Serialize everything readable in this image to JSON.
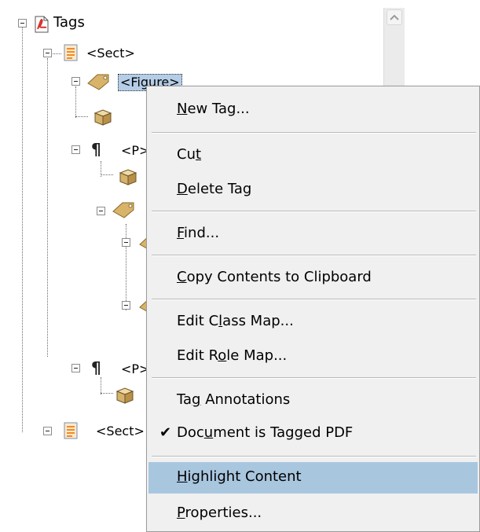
{
  "tree": {
    "root_label": "Tags",
    "sect_label": "<Sect>",
    "figure_label": "<Figure>",
    "p_label": "<P>",
    "sect_label_2": "<Sect>"
  },
  "menu": {
    "new_tag": {
      "pre": "",
      "key": "N",
      "post": "ew Tag..."
    },
    "cut": {
      "pre": "Cu",
      "key": "t",
      "post": ""
    },
    "delete_tag": {
      "pre": "",
      "key": "D",
      "post": "elete Tag"
    },
    "find": {
      "pre": "",
      "key": "F",
      "post": "ind..."
    },
    "copy_contents": {
      "pre": "",
      "key": "C",
      "post": "opy Contents to Clipboard"
    },
    "edit_class_map": {
      "pre": "Edit C",
      "key": "l",
      "post": "ass Map..."
    },
    "edit_role_map": {
      "pre": "Edit R",
      "key": "o",
      "post": "le Map..."
    },
    "tag_annotations": {
      "pre": "Ta",
      "key": "g",
      "post": " Annotations"
    },
    "document_tagged": {
      "pre": "Doc",
      "key": "u",
      "post": "ment is Tagged PDF",
      "checked": true,
      "check_glyph": "✔"
    },
    "highlight_content": {
      "pre": "",
      "key": "H",
      "post": "ighlight Content",
      "highlighted": true
    },
    "properties": {
      "pre": "",
      "key": "P",
      "post": "roperties..."
    }
  },
  "colors": {
    "menu_background": "#f0f0f0",
    "menu_highlight": "#a9c6df",
    "selection_background": "#b5cde6",
    "pdf_icon_red": "#d8322b",
    "tag_icon_gold": "#c9a04a",
    "sect_icon_orange": "#f08a2a"
  }
}
